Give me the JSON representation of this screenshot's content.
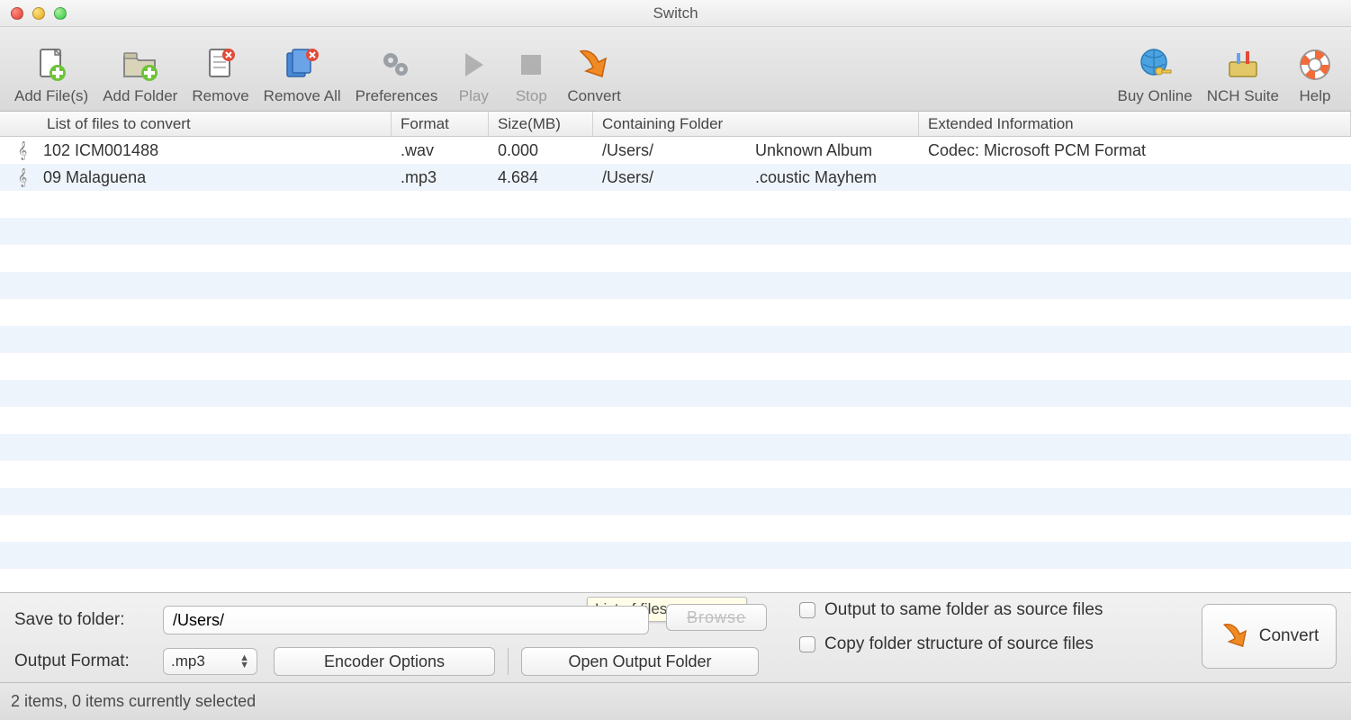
{
  "window": {
    "title": "Switch"
  },
  "toolbar": {
    "left": [
      {
        "key": "addfiles",
        "label": "Add File(s)",
        "icon": "file-add"
      },
      {
        "key": "addfolder",
        "label": "Add Folder",
        "icon": "folder-add"
      },
      {
        "key": "remove",
        "label": "Remove",
        "icon": "file-remove"
      },
      {
        "key": "removeall",
        "label": "Remove All",
        "icon": "files-remove"
      },
      {
        "key": "preferences",
        "label": "Preferences",
        "icon": "gears"
      },
      {
        "key": "play",
        "label": "Play",
        "icon": "play",
        "disabled": true
      },
      {
        "key": "stop",
        "label": "Stop",
        "icon": "stop",
        "disabled": true
      },
      {
        "key": "convert",
        "label": "Convert",
        "icon": "convert-arrow"
      }
    ],
    "right": [
      {
        "key": "buyonline",
        "label": "Buy Online",
        "icon": "globe-key"
      },
      {
        "key": "nchsuite",
        "label": "NCH Suite",
        "icon": "toolbox"
      },
      {
        "key": "help",
        "label": "Help",
        "icon": "lifebuoy"
      }
    ]
  },
  "columns": {
    "file": "List of files to convert",
    "format": "Format",
    "size": "Size(MB)",
    "folder": "Containing Folder",
    "ext": "Extended Information"
  },
  "rows": [
    {
      "name": "102 ICM001488",
      "format": ".wav",
      "size": "0.000",
      "folder": "/Users/",
      "album": "Unknown Album",
      "ext": "Codec: Microsoft PCM Format"
    },
    {
      "name": "09 Malaguena",
      "format": ".mp3",
      "size": "4.684",
      "folder": "/Users/",
      "album": ".coustic Mayhem",
      "ext": ""
    }
  ],
  "bottom": {
    "save_label": "Save to folder:",
    "save_value": "/Users/",
    "browse_label": "Browse",
    "tooltip": "List of files to convert",
    "output_label": "Output Format:",
    "output_value": ".mp3",
    "encoder_btn": "Encoder Options",
    "open_output_btn": "Open Output Folder",
    "chk_same": "Output to same folder as source files",
    "chk_copy": "Copy folder structure of source files",
    "big_convert": "Convert"
  },
  "status": "2 items, 0 items currently selected"
}
